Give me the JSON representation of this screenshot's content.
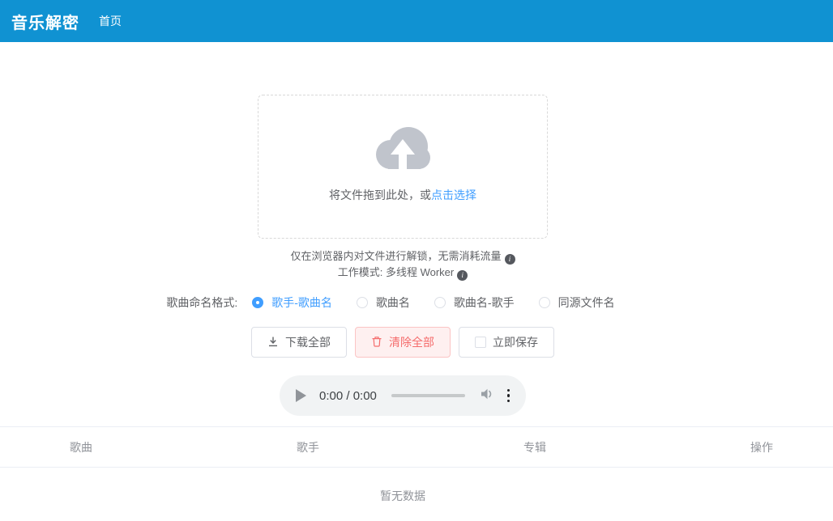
{
  "header": {
    "title": "音乐解密",
    "nav_home": "首页"
  },
  "uploader": {
    "drop_text": "将文件拖到此处，或",
    "click_text": "点击选择"
  },
  "tips": {
    "line1": "仅在浏览器内对文件进行解锁，无需消耗流量",
    "line2": "工作模式: 多线程 Worker",
    "info_glyph": "i"
  },
  "naming": {
    "label": "歌曲命名格式:",
    "options": [
      {
        "label": "歌手-歌曲名",
        "selected": true
      },
      {
        "label": "歌曲名",
        "selected": false
      },
      {
        "label": "歌曲名-歌手",
        "selected": false
      },
      {
        "label": "同源文件名",
        "selected": false
      }
    ]
  },
  "actions": {
    "download_all": "下载全部",
    "clear_all": "清除全部",
    "save_now": "立即保存",
    "save_checked": false
  },
  "player": {
    "time": "0:00 / 0:00"
  },
  "table": {
    "columns": [
      "歌曲",
      "歌手",
      "专辑",
      "操作"
    ],
    "rows": [],
    "empty_text": "暂无数据"
  },
  "icons": {
    "upload": "cloud-upload-icon",
    "info": "info-circle-icon",
    "download": "download-icon",
    "clear": "trash-icon",
    "save": "checkbox-icon",
    "play": "play-icon",
    "volume": "speaker-icon",
    "more": "kebab-menu-icon"
  },
  "colors": {
    "navbar_bg": "#1092d2",
    "link_blue": "#409eff",
    "danger_text": "#f56c6c",
    "danger_bg": "#fef0f0",
    "danger_border": "#fbc4c4",
    "border_gray": "#dcdfe6",
    "text_primary": "#606266",
    "text_secondary": "#909399",
    "table_border": "#ebeef5",
    "player_bg": "#f1f3f4",
    "upload_icon_gray": "#c0c4cc"
  }
}
